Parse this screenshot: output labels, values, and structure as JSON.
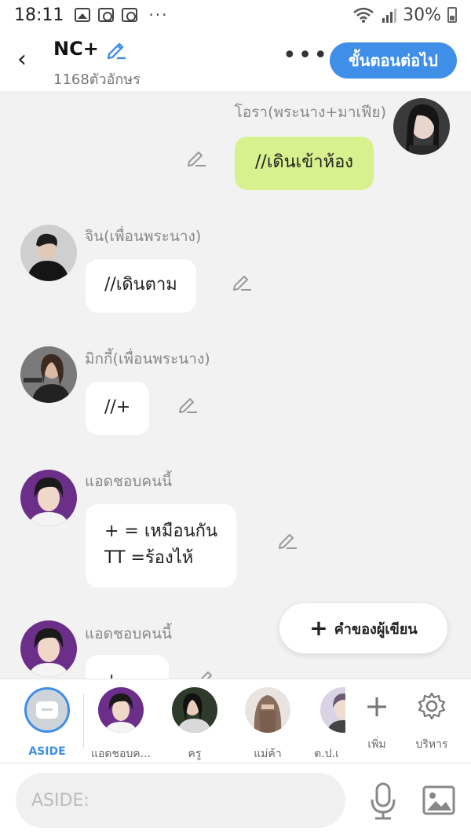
{
  "status_bar": {
    "time": "18:11",
    "dots": "···",
    "battery": "30%"
  },
  "header": {
    "title": "NC+",
    "char_count": "1168ตัวอักษร",
    "more": "•••",
    "next_button": "ขั้นตอนต่อไป",
    "back": "‹"
  },
  "messages": [
    {
      "speaker": "โอรา(พระนาง+มาเฟีย)",
      "text": "//เดินเข้าห้อง",
      "mine": true
    },
    {
      "speaker": "จิน(เพื่อนพระนาง)",
      "text": "//เดินตาม",
      "mine": false
    },
    {
      "speaker": "มิกกี้(เพื่อนพระนาง)",
      "text": "//+",
      "mine": false
    },
    {
      "speaker": "แอดชอบคนนี้",
      "text": "+  =  เหมือนกัน\nTT  =ร้องไห้",
      "mine": false
    },
    {
      "speaker": "แอดชอบคนนี้",
      "text": "+",
      "mine": false
    }
  ],
  "author_note_button": {
    "plus": "+",
    "label": "คำของผู้เขียน"
  },
  "character_bar": {
    "aside_label": "ASIDE",
    "characters": [
      {
        "label": "แอดชอบค..."
      },
      {
        "label": "ครู"
      },
      {
        "label": "แม่ค้า"
      },
      {
        "label": "ต.ป.เ"
      }
    ],
    "add_label": "เพิ่ม",
    "manage_label": "บริหาร",
    "add_symbol": "+"
  },
  "input": {
    "placeholder": "ASIDE:"
  },
  "colors": {
    "accent": "#3f8fe8",
    "my_bubble": "#d6f18d",
    "background": "#f2f2f2"
  }
}
